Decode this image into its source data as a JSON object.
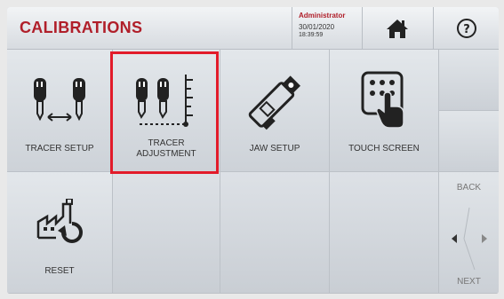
{
  "header": {
    "title": "CALIBRATIONS",
    "user": "Administrator",
    "date": "30/01/2020",
    "time": "18:39:59"
  },
  "tiles": [
    {
      "label": "TRACER SETUP",
      "icon": "tracer-setup-icon"
    },
    {
      "label": "TRACER ADJUSTMENT",
      "icon": "tracer-adjustment-icon",
      "selected": true
    },
    {
      "label": "JAW SETUP",
      "icon": "jaw-setup-icon"
    },
    {
      "label": "TOUCH SCREEN",
      "icon": "touch-screen-icon"
    },
    {
      "label": "RESET",
      "icon": "factory-reset-icon"
    }
  ],
  "nav": {
    "back": "BACK",
    "next": "NEXT"
  },
  "colors": {
    "accent": "#b01f2a",
    "highlight": "#e21b2a"
  }
}
